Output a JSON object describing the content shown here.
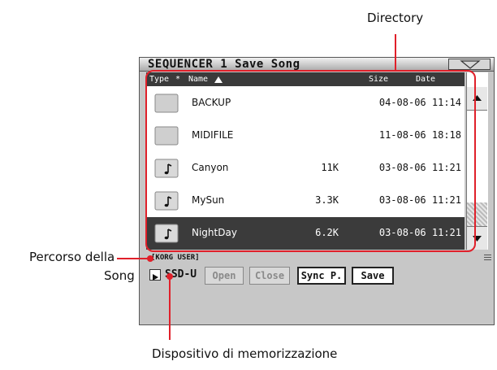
{
  "callouts": {
    "directory": "Directory",
    "path_line1": "Percorso della",
    "path_line2": "Song",
    "device": "Dispositivo di memorizzazione"
  },
  "window": {
    "title": "SEQUENCER 1  Save Song",
    "menu_icon": "dropdown-triangle-icon"
  },
  "file_list": {
    "columns": {
      "type": "Type",
      "sort": "*",
      "name": "Name",
      "size": "Size",
      "date": "Date"
    },
    "rows": [
      {
        "icon": "folder-icon",
        "name": "BACKUP",
        "size": "",
        "date": "04-08-06 11:14"
      },
      {
        "icon": "folder-icon",
        "name": "MIDIFILE",
        "size": "",
        "date": "11-08-06 18:18"
      },
      {
        "icon": "midi-file-icon",
        "name": "Canyon",
        "size": "11K",
        "date": "03-08-06 11:21"
      },
      {
        "icon": "midi-file-icon",
        "name": "MySun",
        "size": "3.3K",
        "date": "03-08-06 11:21"
      },
      {
        "icon": "midi-file-icon",
        "name": "NightDay",
        "size": "6.2K",
        "date": "03-08-06 11:21",
        "selected": true
      }
    ]
  },
  "path": "[KORG USER]",
  "device": {
    "label": "SSD-U"
  },
  "buttons": {
    "open": "Open",
    "close": "Close",
    "sync": "Sync P.",
    "save": "Save"
  },
  "colors": {
    "callout_red": "#e0202a",
    "selected_row": "#3b3b3b"
  }
}
